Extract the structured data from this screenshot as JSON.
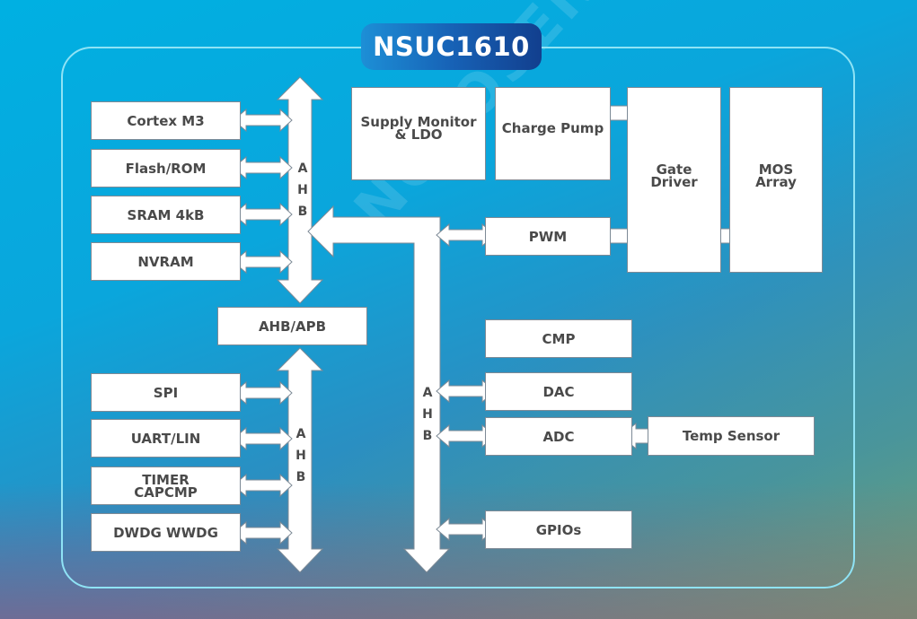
{
  "title": "NSUC1610",
  "watermark": "NOVOSENSE",
  "colors": {
    "background_top": "#00b0e2",
    "background_bottom_left": "#9a5a7c",
    "background_bottom_right": "#6a9a7c",
    "frame_border": "#8fe3f5",
    "title_pill_start": "#1d8fd6",
    "title_pill_end": "#123f8e",
    "block_fill": "#ffffff",
    "block_text": "#4a4a4a"
  },
  "left_bus_top": {
    "label": [
      "A",
      "H",
      "B"
    ],
    "blocks": [
      {
        "id": "cortex-m3",
        "label": "Cortex M3"
      },
      {
        "id": "flash-rom",
        "label": "Flash/ROM"
      },
      {
        "id": "sram",
        "label": "SRAM 4kB"
      },
      {
        "id": "nvram",
        "label": "NVRAM"
      }
    ]
  },
  "bridge": {
    "label": "AHB/APB"
  },
  "left_bus_bottom": {
    "label": [
      "A",
      "H",
      "B"
    ],
    "blocks": [
      {
        "id": "spi",
        "label": "SPI"
      },
      {
        "id": "uart-lin",
        "label": "UART/LIN"
      },
      {
        "id": "timer-capcmp",
        "label": "TIMER\nCAPCMP"
      },
      {
        "id": "dwdg-wwdg",
        "label": "DWDG WWDG"
      }
    ]
  },
  "center_bus": {
    "label": [
      "A",
      "H",
      "B"
    ],
    "blocks": [
      {
        "id": "pwm",
        "label": "PWM"
      },
      {
        "id": "cmp",
        "label": "CMP"
      },
      {
        "id": "dac",
        "label": "DAC"
      },
      {
        "id": "adc",
        "label": "ADC"
      },
      {
        "id": "gpios",
        "label": "GPIOs"
      }
    ]
  },
  "power_blocks": [
    {
      "id": "supply-monitor-ldo",
      "label": "Supply Monitor\n& LDO"
    },
    {
      "id": "charge-pump",
      "label": "Charge Pump"
    },
    {
      "id": "gate-driver",
      "label": "Gate\nDriver"
    },
    {
      "id": "mos-array",
      "label": "MOS\nArray"
    }
  ],
  "sensor": {
    "id": "temp-sensor",
    "label": "Temp Sensor"
  }
}
